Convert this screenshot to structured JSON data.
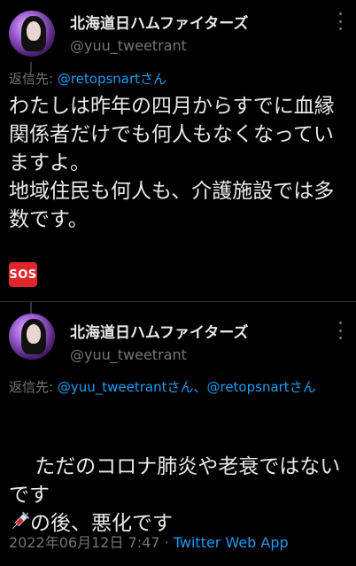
{
  "tweet1": {
    "name": "北海道日ハムファイターズ",
    "handle": "@yuu_tweetrant",
    "reply_prefix": "返信先: ",
    "reply_to": "@retopsnartさん",
    "body": "わたしは昨年の四月からすでに血縁関係者だけでも何人もなくなっていますよ。\n地域住民も何人も、介護施設では多数です。",
    "emoji": "sos-emoji",
    "emoji_text": "SOS"
  },
  "tweet2": {
    "name": "北海道日ハムファイターズ",
    "handle": "@yuu_tweetrant",
    "reply_prefix": "返信先: ",
    "reply_to_1": "@yuu_tweetrantさん",
    "reply_sep": "、",
    "reply_to_2": "@retopsnartさん",
    "body_line1": "ただのコロナ肺炎や老衰ではないです",
    "body_line2": "の後、悪化です",
    "emoji": "syringe-emoji",
    "timestamp": "2022年06月12日 7:47",
    "separator": " · ",
    "client": "Twitter Web App"
  },
  "colors": {
    "background": "#000000",
    "text": "#e7e9ea",
    "muted": "#71767b",
    "link": "#1d9bf0",
    "sos": "#e0262b"
  }
}
